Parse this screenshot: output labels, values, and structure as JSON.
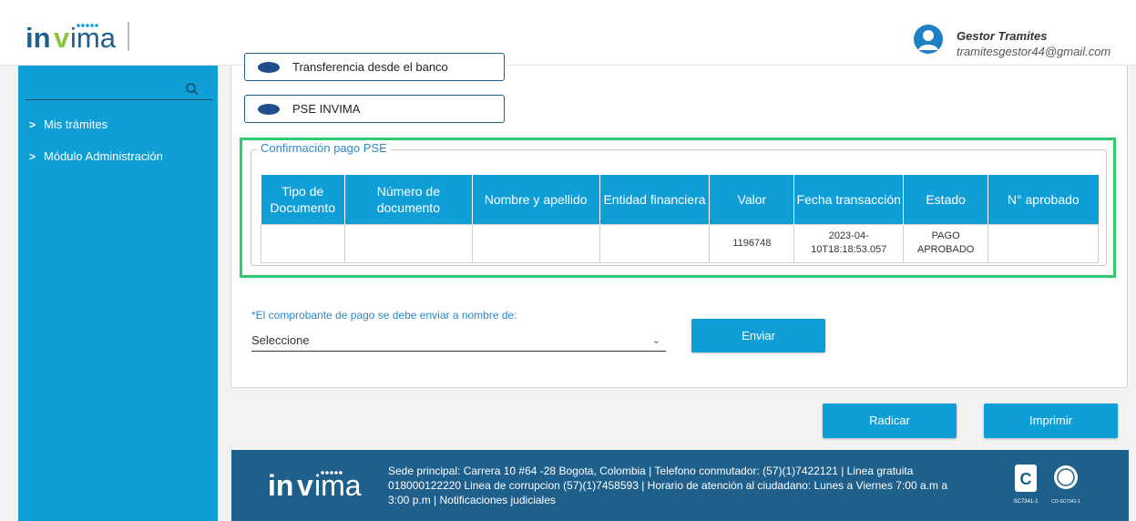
{
  "header": {
    "logo_text": "invima",
    "user_name": "Gestor Tramites",
    "user_email": "tramitesgestor44@gmail.com"
  },
  "sidebar": {
    "items": [
      {
        "label": "Mis trámites"
      },
      {
        "label": "Módulo Administración"
      }
    ]
  },
  "payment_options": [
    {
      "label": "Transferencia desde el banco"
    },
    {
      "label": "PSE INVIMA"
    }
  ],
  "pse_confirmation": {
    "legend": "Confirmación pago PSE",
    "columns": [
      "Tipo de Documento",
      "Número de documento",
      "Nombre y apellido",
      "Entidad financiera",
      "Valor",
      "Fecha transacción",
      "Estado",
      "N° aprobado"
    ],
    "rows": [
      {
        "tipo_documento": "",
        "numero_documento": "",
        "nombre_apellido": "",
        "entidad_financiera": "",
        "valor": "1196748",
        "fecha_transaccion": "2023-04-10T18:18:53.057",
        "estado": "PAGO APROBADO",
        "numero_aprobado": ""
      }
    ]
  },
  "send_form": {
    "label": "*El comprobante de pago se debe enviar a nombre de:",
    "selected": "Seleccione",
    "send_button": "Enviar"
  },
  "actions": {
    "radicar": "Radicar",
    "imprimir": "Imprimir"
  },
  "footer": {
    "text": "Sede principal: Carrera 10 #64 -28 Bogota, Colombia | Telefono conmutador: (57)(1)7422121 | Linea gratuita 018000122220 Linea de corrupcion (57)(1)7458593 | Horario de atención al ciudadano: Lunes a Viernes 7:00 a.m a 3:00 p.m | Notificaciones judiciales",
    "cert_1": "SC7341-1",
    "cert_2": "CO-SC7341-1"
  },
  "colors": {
    "brand_blue": "#0f9ed5",
    "footer_navy": "#1e5f8c",
    "highlight_green": "#2ecc71"
  }
}
